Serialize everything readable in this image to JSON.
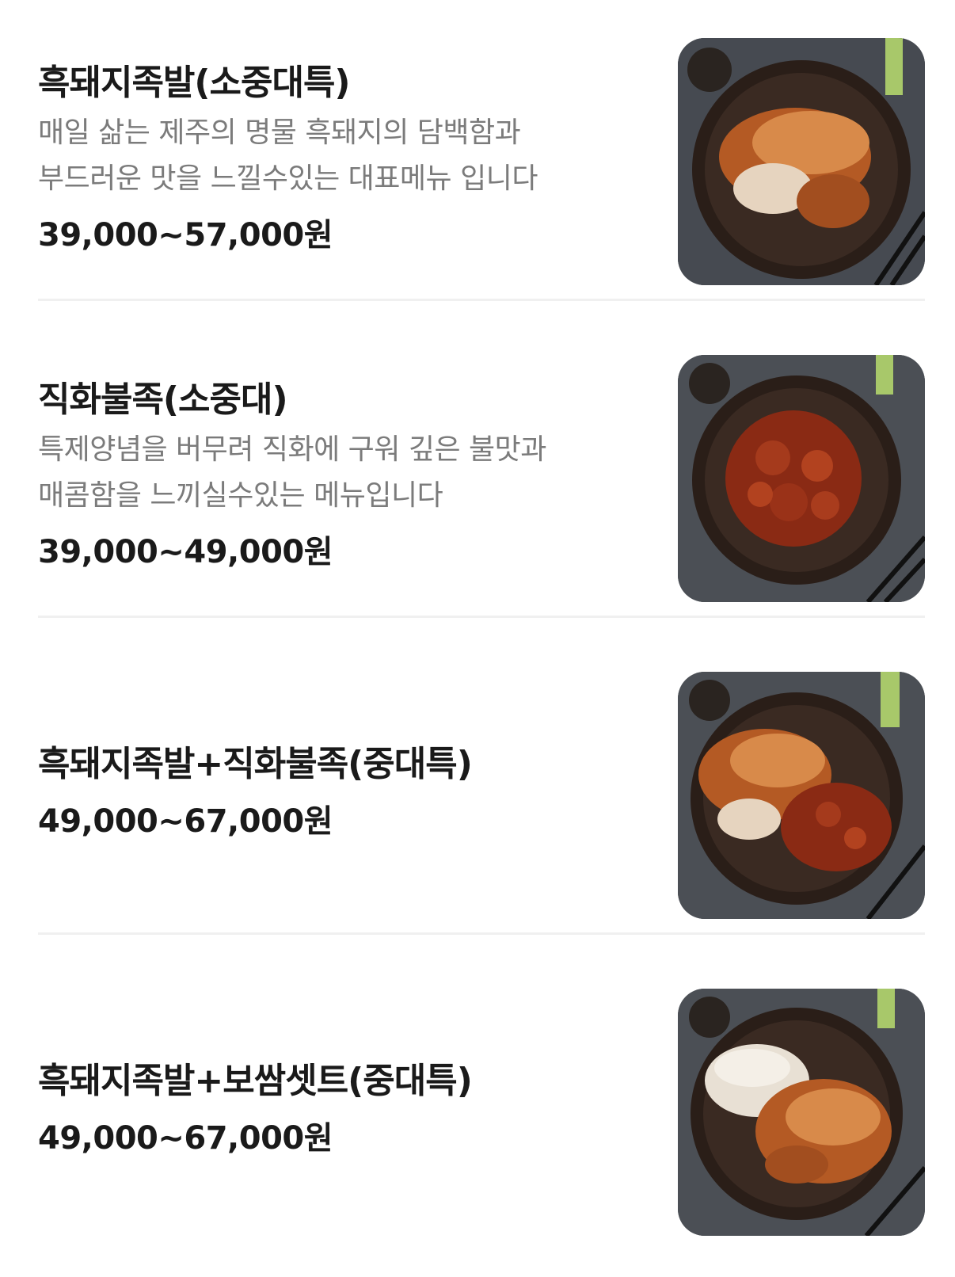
{
  "menu": {
    "items": [
      {
        "name": "흑돼지족발(소중대특)",
        "description_lines": [
          "매일 삶는 제주의 명물 흑돼지의 담백함과",
          "부드러운 맛을 느낄수있는 대표메뉴 입니다"
        ],
        "price": "39,000~57,000원",
        "image_icon": "jokbal-plate-icon"
      },
      {
        "name": "직화불족(소중대)",
        "description_lines": [
          "특제양념을 버무려 직화에 구워 깊은 불맛과",
          "매콤함을 느끼실수있는 메뉴입니다"
        ],
        "price": "39,000~49,000원",
        "image_icon": "spicy-jokbal-plate-icon"
      },
      {
        "name": "흑돼지족발+직화불족(중대특)",
        "description_lines": [],
        "price": "49,000~67,000원",
        "image_icon": "combo-jokbal-plate-icon"
      },
      {
        "name": "흑돼지족발+보쌈셋트(중대특)",
        "description_lines": [],
        "price": "49,000~67,000원",
        "image_icon": "bossam-jokbal-plate-icon"
      }
    ]
  },
  "colors": {
    "title": "#1a1a1a",
    "description": "#7b7b7b",
    "divider": "#f0f0f0",
    "plate": "#2a1e18",
    "table": "#4b4f55",
    "jokbal": "#b45a24",
    "spicy": "#8a2a14",
    "bossam": "#e8e0d4"
  }
}
